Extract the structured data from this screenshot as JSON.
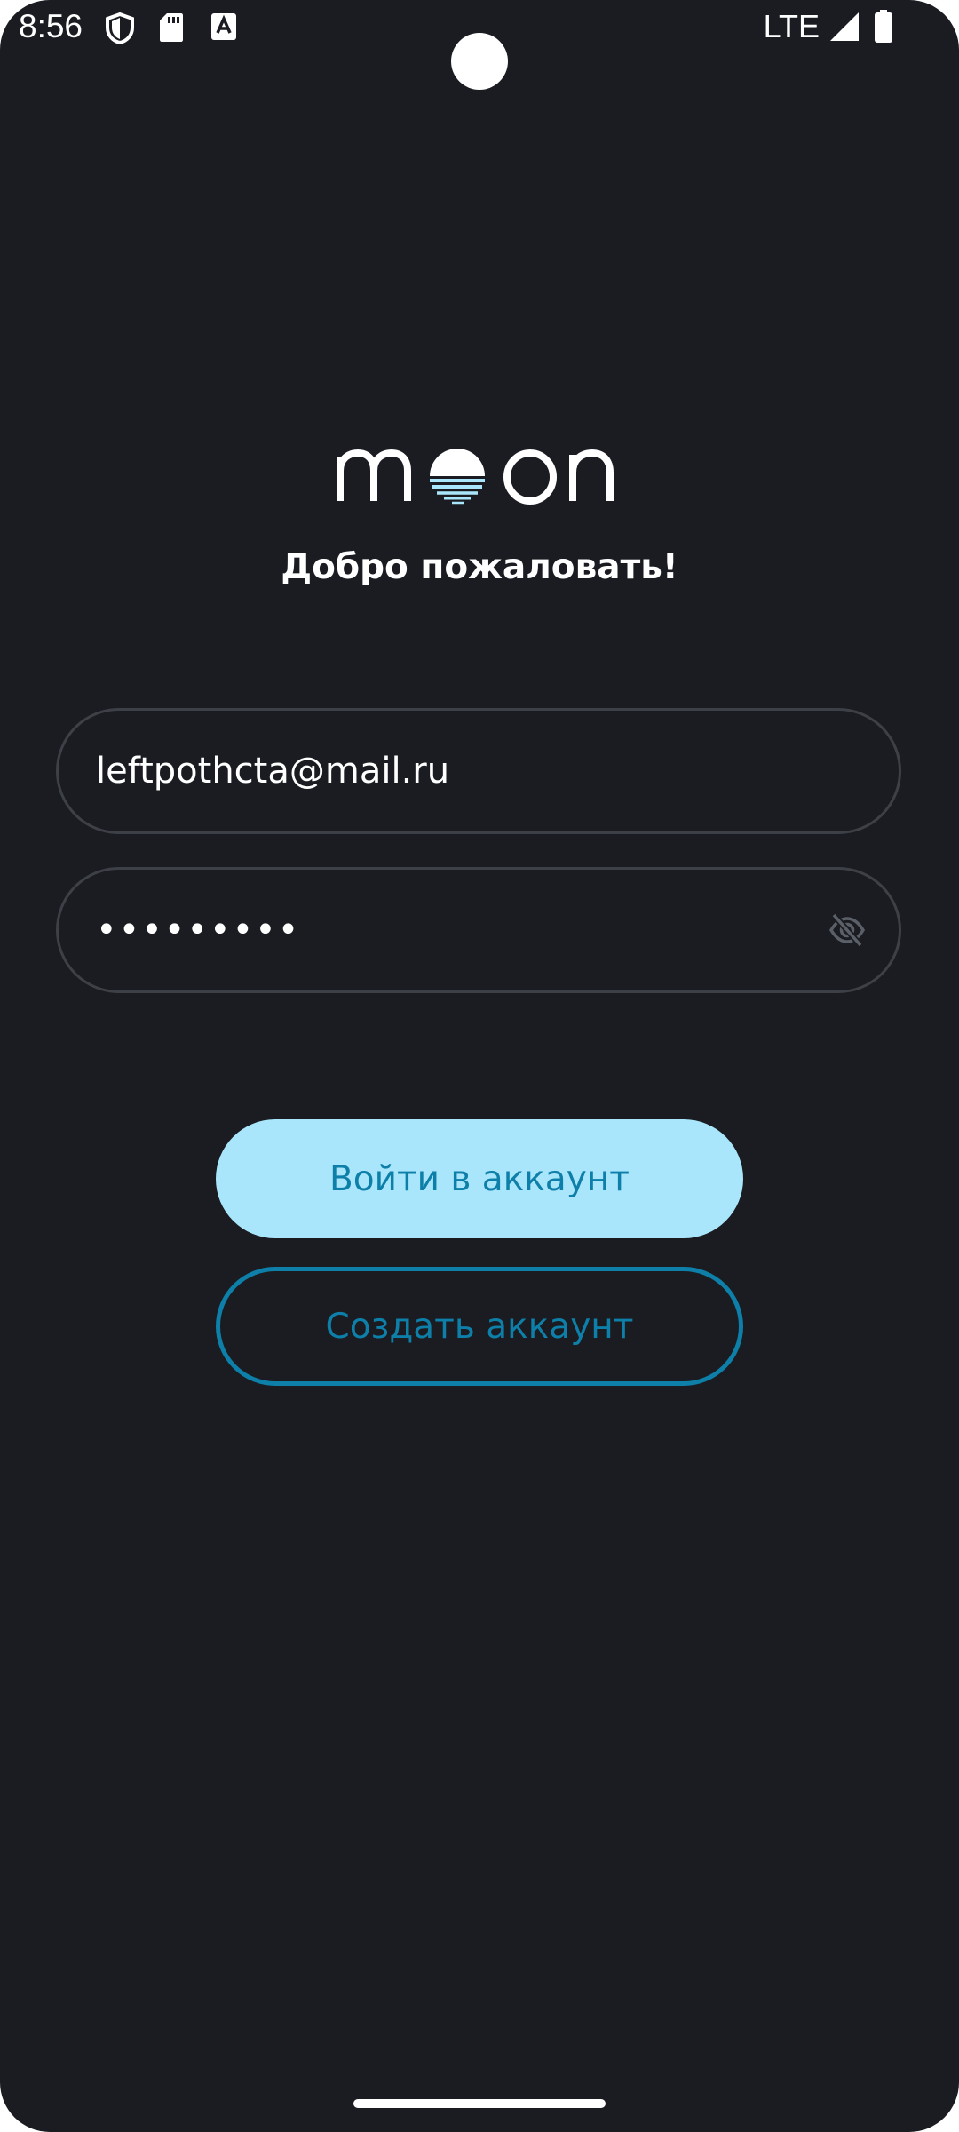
{
  "status_bar": {
    "time": "8:56",
    "network": "LTE",
    "icons": [
      "shield-icon",
      "sd-card-icon",
      "a-notification-icon",
      "signal-icon",
      "battery-icon"
    ]
  },
  "logo": {
    "text": "moon",
    "accent_color": "#a9e6fc"
  },
  "welcome": {
    "title": "Добро пожаловать!"
  },
  "form": {
    "email_value": "leftpothcta@mail.ru",
    "password_value": "•••••••••",
    "password_toggle_icon": "eye-off-icon"
  },
  "buttons": {
    "login_label": "Войти в аккаунт",
    "register_label": "Создать аккаунт"
  },
  "colors": {
    "background": "#1a1c21",
    "primary_button": "#a9e6fc",
    "primary_text": "#0d7fa8",
    "field_border": "#3d4047"
  }
}
